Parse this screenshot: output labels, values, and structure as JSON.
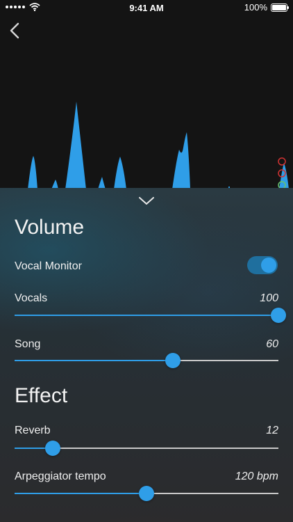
{
  "status_bar": {
    "time": "9:41 AM",
    "battery": "100%",
    "battery_level": 1.0,
    "signal_icon": "signal-dots-icon",
    "wifi_icon": "wifi-icon"
  },
  "nav": {
    "back_icon": "chevron-left-icon"
  },
  "sheet": {
    "collapse_icon": "chevron-down-icon",
    "volume": {
      "title": "Volume",
      "vocal_monitor": {
        "label": "Vocal Monitor",
        "on": true
      },
      "vocals": {
        "label": "Vocals",
        "value": "100",
        "level": 1.0
      },
      "song": {
        "label": "Song",
        "value": "60",
        "level": 0.6
      }
    },
    "effect": {
      "title": "Effect",
      "reverb": {
        "label": "Reverb",
        "value": "12",
        "level": 0.146
      },
      "arpeggiator": {
        "label": "Arpeggiator tempo",
        "value": "120 bpm",
        "level": 0.5
      }
    }
  },
  "colors": {
    "accent": "#2f9ee8",
    "waveform": "#2f9ee8",
    "marker_red": "#d23333",
    "marker_green": "#6bc26b"
  }
}
